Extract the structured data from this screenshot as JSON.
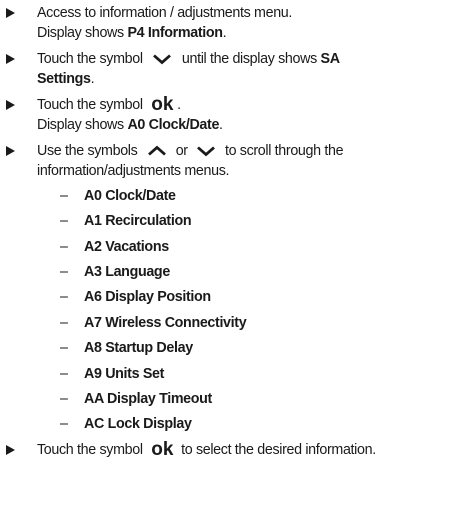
{
  "steps": [
    {
      "line1": "Access to information / adjustments menu.",
      "line2_pre": "Display shows ",
      "line2_bold": "P4 Information",
      "line2_post": "."
    },
    {
      "pre": "Touch the symbol",
      "icon": "chevron-down-icon",
      "mid": "until the display shows ",
      "bold1": "SA",
      "bold2": "Settings",
      "post": "."
    },
    {
      "pre": "Touch the symbol",
      "icon_text": "ok",
      "post": ".",
      "line2_pre": "Display shows ",
      "line2_bold": "A0 Clock/Date",
      "line2_post": "."
    },
    {
      "pre": "Use the symbols",
      "icon1": "chevron-up-icon",
      "or": "or",
      "icon2": "chevron-down-icon",
      "post": "to scroll through the",
      "line2": "information/adjustments menus."
    },
    {
      "pre": "Touch the symbol",
      "icon_text": "ok",
      "post": "to select the desired information."
    }
  ],
  "menu_dash": "–",
  "menu_items": [
    "A0 Clock/Date",
    "A1 Recirculation",
    "A2 Vacations",
    "A3 Language",
    "A6 Display Position",
    "A7 Wireless Connectivity",
    "A8 Startup Delay",
    "A9 Units Set",
    "AA Display Timeout",
    "AC Lock Display"
  ],
  "colors": {
    "text": "#1a1a1a",
    "background": "#ffffff"
  }
}
